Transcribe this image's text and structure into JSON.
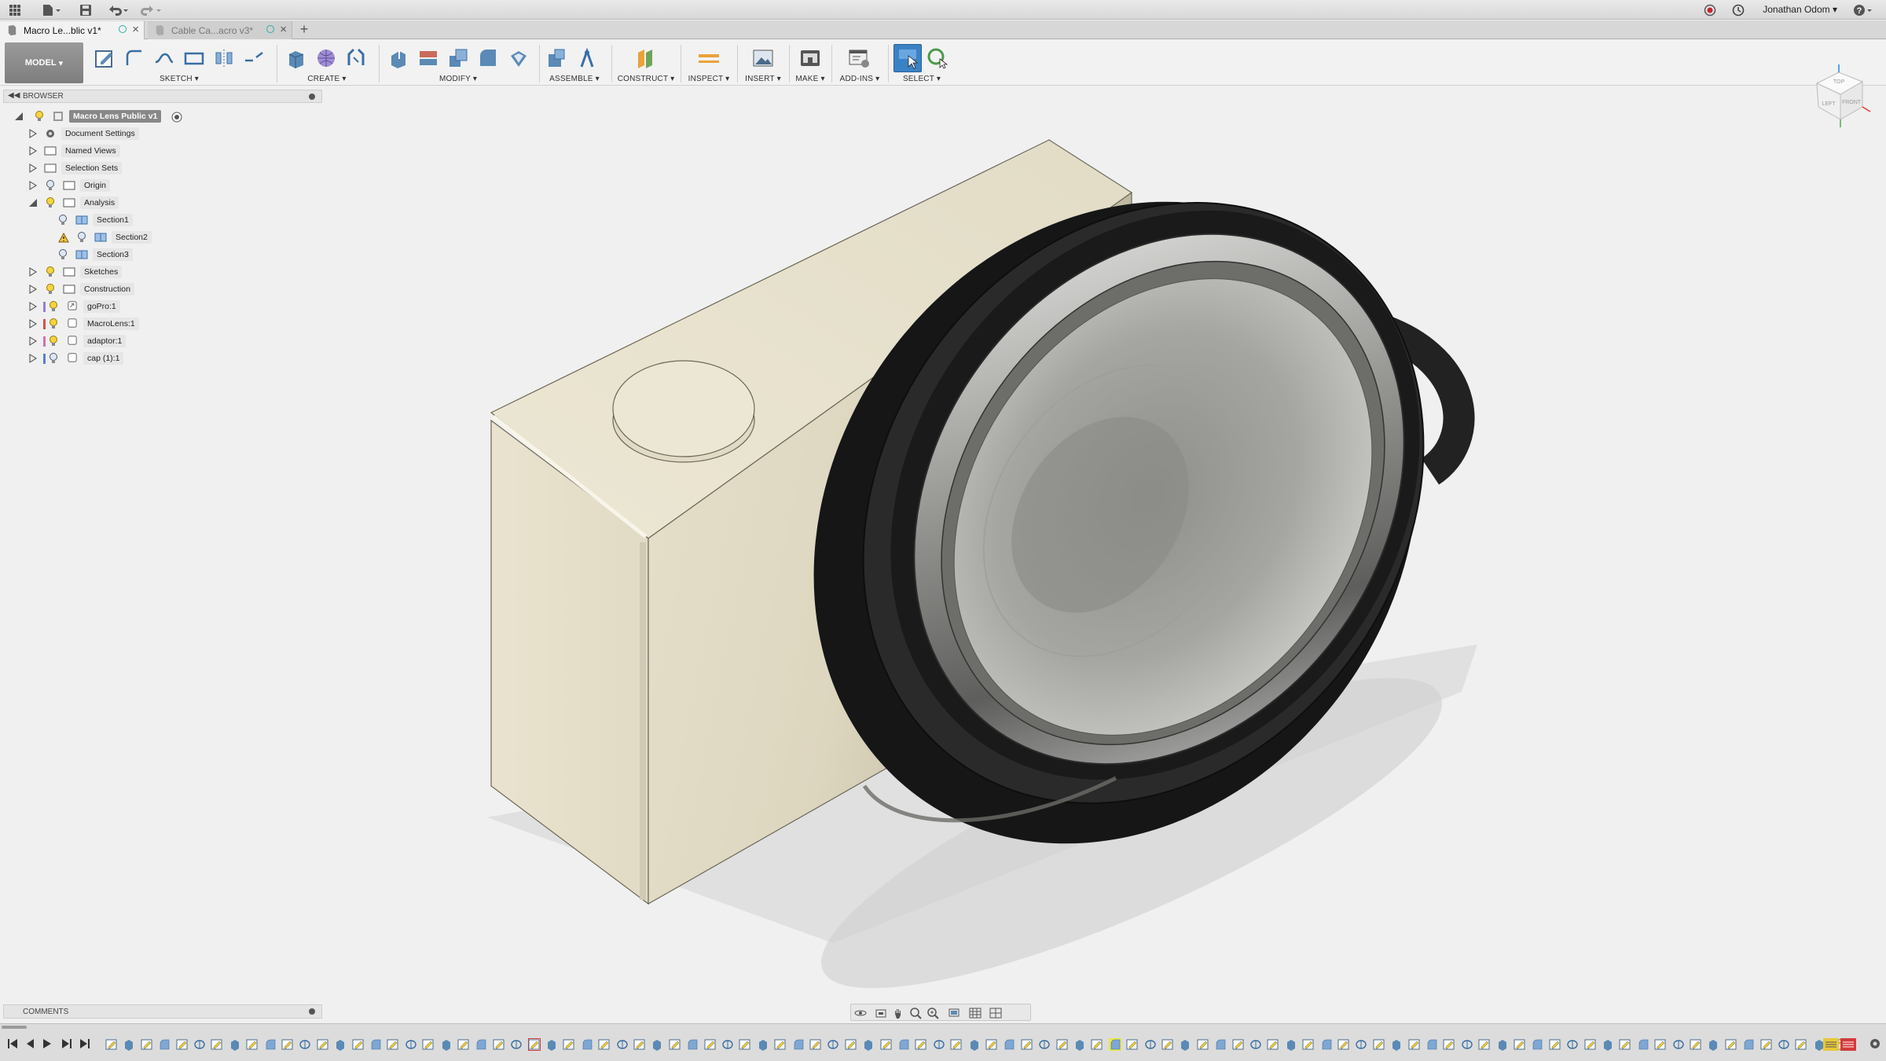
{
  "titlebar": {
    "user_name": "Jonathan Odom",
    "icons": [
      "apps-grid-icon",
      "file-menu-icon",
      "save-icon",
      "undo-icon",
      "redo-icon",
      "record-icon",
      "history-clock-icon",
      "help-icon"
    ]
  },
  "tabs": [
    {
      "label": "Macro Le...blic v1*",
      "active": true
    },
    {
      "label": "Cable Ca...acro v3*",
      "active": false
    }
  ],
  "toolbar": {
    "workspace": "MODEL",
    "groups": {
      "sketch": "SKETCH",
      "create": "CREATE",
      "modify": "MODIFY",
      "assemble": "ASSEMBLE",
      "construct": "CONSTRUCT",
      "inspect": "INSPECT",
      "insert": "INSERT",
      "make": "MAKE",
      "addins": "ADD-INS",
      "select": "SELECT"
    }
  },
  "browser": {
    "header": "BROWSER",
    "root": "Macro Lens Public v1",
    "nodes": {
      "document_settings": "Document Settings",
      "named_views": "Named Views",
      "selection_sets": "Selection Sets",
      "origin": "Origin",
      "analysis": "Analysis",
      "section1": "Section1",
      "section2": "Section2",
      "section3": "Section3",
      "sketches": "Sketches",
      "construction": "Construction",
      "gopro": "goPro:1",
      "macrolens": "MacroLens:1",
      "adaptor": "adaptor:1",
      "cap": "cap (1):1"
    }
  },
  "comments": {
    "label": "COMMENTS"
  },
  "viewcube": {
    "faces": [
      "TOP",
      "FRONT",
      "LEFT"
    ]
  },
  "colors": {
    "body_fill": "#e9e3d0",
    "lens_ring": "#1e1e1e",
    "timeline_highlight": "#e8e84a",
    "timeline_marker": "#d43a3a"
  }
}
